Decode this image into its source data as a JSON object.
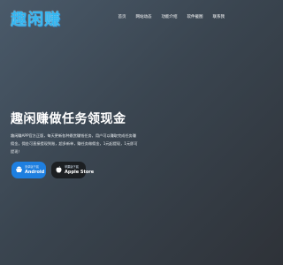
{
  "logo": {
    "text": "趣闲赚"
  },
  "nav": {
    "items": [
      {
        "label": "首页"
      },
      {
        "label": "网站动态"
      },
      {
        "label": "功能介绍"
      },
      {
        "label": "软件截图"
      },
      {
        "label": "联系我"
      }
    ]
  },
  "hero": {
    "title": "趣闲赚做任务领现金",
    "description": "趣闲赚APP官方正版，每天更新各种悬赏赚钱任务，用户可以赚取完成任务赚佣金，佣金可直接提现到账，超多新单，赚任务做佣金，1元起提现，1元即可提现！"
  },
  "downloads": {
    "android": {
      "small": "安卓版下载",
      "label": "Android",
      "icon": "android-icon"
    },
    "apple": {
      "small": "苹果版下载",
      "label": "Apple Store",
      "icon": "apple-icon"
    }
  },
  "colors": {
    "logo": "#33b6f0",
    "android_button": "#1e7fe0",
    "apple_button": "#1c1f22"
  }
}
